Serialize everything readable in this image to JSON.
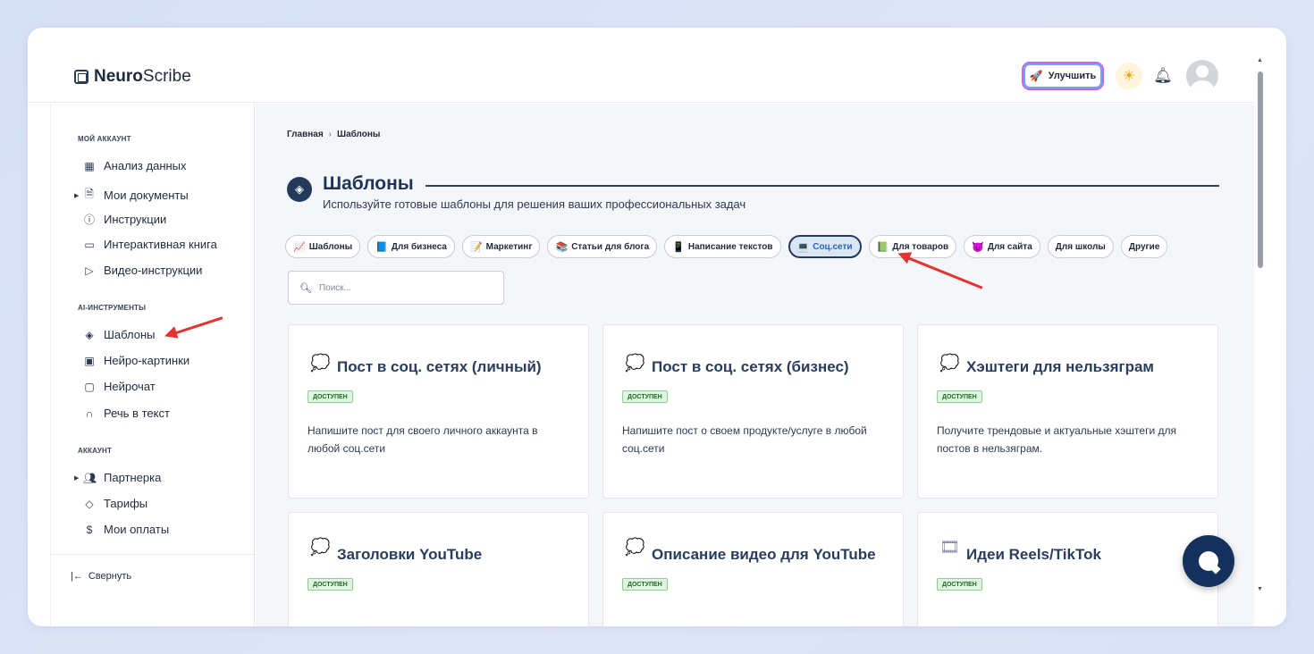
{
  "app": {
    "logo_bold": "Neuro",
    "logo_light": "Scribe"
  },
  "header": {
    "upgrade_label": "Улучшить",
    "upgrade_icon": "rocket-icon",
    "theme_icon": "sun-icon",
    "bell_icon": "bell-icon"
  },
  "sidebar": {
    "sections": [
      {
        "title": "МОЙ АККАУНТ",
        "items": [
          {
            "label": "Анализ данных",
            "icon": "grid-icon",
            "caret": false
          },
          {
            "label": "Мои документы",
            "icon": "document-icon",
            "caret": true
          },
          {
            "label": "Инструкции",
            "icon": "help-icon",
            "caret": false
          },
          {
            "label": "Интерактивная книга",
            "icon": "book-icon",
            "caret": false
          },
          {
            "label": "Видео-инструкции",
            "icon": "video-icon",
            "caret": false
          }
        ]
      },
      {
        "title": "AI-ИНСТРУМЕНТЫ",
        "items": [
          {
            "label": "Шаблоны",
            "icon": "layers-icon",
            "caret": false
          },
          {
            "label": "Нейро-картинки",
            "icon": "image-icon",
            "caret": false
          },
          {
            "label": "Нейрочат",
            "icon": "chat-icon",
            "caret": false
          },
          {
            "label": "Речь в текст",
            "icon": "headphones-icon",
            "caret": false
          }
        ]
      },
      {
        "title": "АККАУНТ",
        "items": [
          {
            "label": "Партнерка",
            "icon": "users-icon",
            "caret": true
          },
          {
            "label": "Тарифы",
            "icon": "tag-icon",
            "caret": false
          },
          {
            "label": "Мои оплаты",
            "icon": "dollar-icon",
            "caret": false
          }
        ]
      }
    ],
    "collapse_label": "Свернуть"
  },
  "main": {
    "breadcrumb": [
      "Главная",
      "Шаблоны"
    ],
    "breadcrumb_sep": "›",
    "title": "Шаблоны",
    "subtitle": "Используйте готовые шаблоны для решения ваших профессиональных задач",
    "chips": [
      {
        "label": "Шаблоны",
        "icon": "📈",
        "active": false
      },
      {
        "label": "Для бизнеса",
        "icon": "📘",
        "active": false
      },
      {
        "label": "Маркетинг",
        "icon": "📝",
        "active": false
      },
      {
        "label": "Статьи для блога",
        "icon": "📚",
        "active": false
      },
      {
        "label": "Написание текстов",
        "icon": "📱",
        "active": false
      },
      {
        "label": "Соц.сети",
        "icon": "💻",
        "active": true
      },
      {
        "label": "Для товаров",
        "icon": "📗",
        "active": false
      },
      {
        "label": "Для сайта",
        "icon": "😈",
        "active": false
      },
      {
        "label": "Для школы",
        "icon": "",
        "active": false
      },
      {
        "label": "Другие",
        "icon": "",
        "active": false
      }
    ],
    "search_placeholder": "Поиск...",
    "cards": [
      {
        "title": "Пост в соц. сетях (личный)",
        "badge": "ДОСТУПЕН",
        "desc": "Напишите пост для своего личного аккаунта в любой соц.сети",
        "icon": "💭"
      },
      {
        "title": "Пост в соц. сетях (бизнес)",
        "badge": "ДОСТУПЕН",
        "desc": "Напишите пост о своем продукте/услуге в любой соц.сети",
        "icon": "💭"
      },
      {
        "title": "Хэштеги для нельзяграм",
        "badge": "ДОСТУПЕН",
        "desc": "Получите трендовые и актуальные хэштеги для постов в нельзяграм.",
        "icon": "💭"
      },
      {
        "title": "Заголовки YouTube",
        "badge": "ДОСТУПЕН",
        "desc": "",
        "icon": "💭"
      },
      {
        "title": "Описание видео для YouTube",
        "badge": "ДОСТУПЕН",
        "desc": "",
        "icon": "💭"
      },
      {
        "title": "Идеи Reels/TikTok",
        "badge": "ДОСТУПЕН",
        "desc": "",
        "icon": "🎞"
      }
    ]
  },
  "colors": {
    "accent": "#243a5a",
    "badge_bg": "#dff5df",
    "arrow": "#e5332f"
  }
}
